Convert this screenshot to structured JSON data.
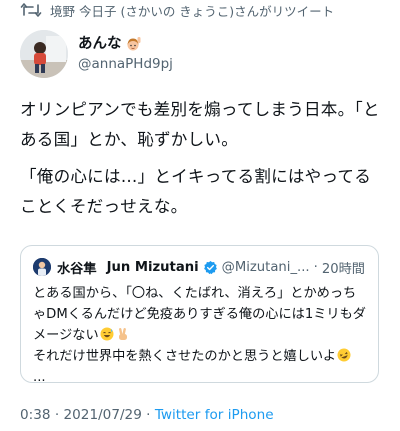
{
  "retweet": {
    "icon": "retweet-icon",
    "text": "境野 今日子 (さかいの きょうこ)さんがリツイート"
  },
  "author": {
    "name": "あんな",
    "name_emoji": "raising-hand-girl-emoji",
    "handle": "@annaPHd9pj"
  },
  "tweet": {
    "paragraphs": [
      "オリンピアンでも差別を煽ってしまう日本。「とある国」とか、恥ずかしい。",
      "「俺の心には…」とイキってる割にはやってることくそだっせえな。"
    ]
  },
  "quote": {
    "name_ja": "水谷隼",
    "name_en": "Jun Mizutani",
    "verified_icon": "verified-badge-icon",
    "handle": "@Mizutani_...",
    "separator": "·",
    "time": "20時間",
    "text_line1": "とある国から、「〇ね、くたばれ、消えろ」とかめっちゃDMくるんだけど免疫ありすぎる俺の心には1ミリもダメージない",
    "text_line1_emojis": [
      "grinning-sweat-emoji",
      "victory-hand-emoji"
    ],
    "text_line2": "それだけ世界中を熱くさせたのかと思うと嬉しいよ",
    "text_line2_emoji": "rolling-laughing-emoji",
    "ellipsis": "..."
  },
  "meta": {
    "time": "0:38",
    "separator1": " · ",
    "date": "2021/07/29",
    "separator2": " · ",
    "source": "Twitter for iPhone"
  },
  "colors": {
    "muted": "#536471",
    "link": "#1d9bf0",
    "border": "#cfd9de",
    "verified": "#1d9bf0"
  }
}
